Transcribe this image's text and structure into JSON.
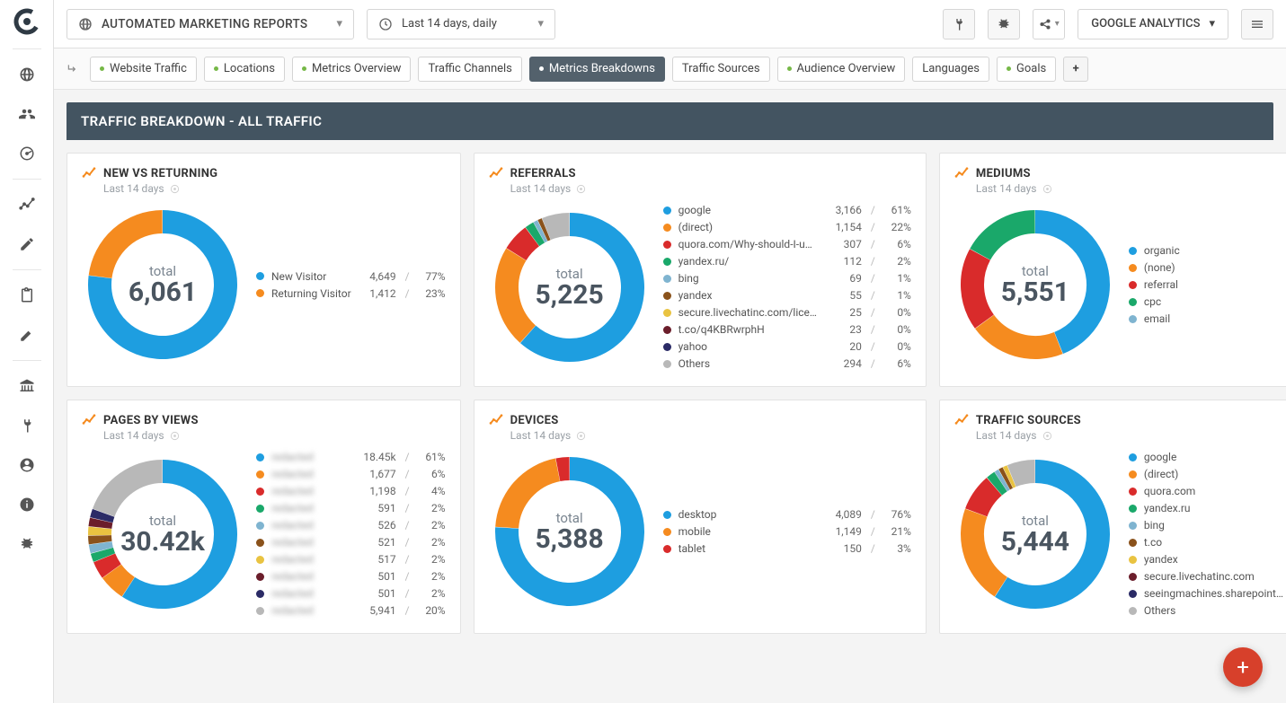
{
  "header": {
    "report_name": "AUTOMATED MARKETING REPORTS",
    "date_range": "Last 14 days, daily",
    "account": "GOOGLE ANALYTICS"
  },
  "tabs": [
    {
      "label": "Website Traffic",
      "dot": true
    },
    {
      "label": "Locations",
      "dot": true
    },
    {
      "label": "Metrics Overview",
      "dot": true
    },
    {
      "label": "Traffic Channels",
      "dot": false
    },
    {
      "label": "Metrics Breakdowns",
      "dot": true,
      "active": true
    },
    {
      "label": "Traffic Sources",
      "dot": false
    },
    {
      "label": "Audience Overview",
      "dot": true
    },
    {
      "label": "Languages",
      "dot": false
    },
    {
      "label": "Goals",
      "dot": true
    }
  ],
  "section_title": "TRAFFIC BREAKDOWN - ALL TRAFFIC",
  "period_label": "Last 14 days",
  "total_label": "total",
  "palette": [
    "#1e9ee0",
    "#f58b1f",
    "#d92b2b",
    "#1aa86a",
    "#7fb4d0",
    "#8a521b",
    "#e9c341",
    "#6b1e2b",
    "#2b2b66",
    "#b8b8b8"
  ],
  "cards": [
    {
      "title": "NEW VS RETURNING",
      "total": "6,061",
      "items": [
        {
          "name": "New Visitor",
          "value": "4,649",
          "pct": "77%"
        },
        {
          "name": "Returning Visitor",
          "value": "1,412",
          "pct": "23%"
        }
      ]
    },
    {
      "title": "REFERRALS",
      "total": "5,225",
      "items": [
        {
          "name": "google",
          "value": "3,166",
          "pct": "61%"
        },
        {
          "name": "(direct)",
          "value": "1,154",
          "pct": "22%"
        },
        {
          "name": "quora.com/Why-should-I-u…",
          "value": "307",
          "pct": "6%"
        },
        {
          "name": "yandex.ru/",
          "value": "112",
          "pct": "2%"
        },
        {
          "name": "bing",
          "value": "69",
          "pct": "1%"
        },
        {
          "name": "yandex",
          "value": "55",
          "pct": "1%"
        },
        {
          "name": "secure.livechatinc.com/lice…",
          "value": "25",
          "pct": "0%"
        },
        {
          "name": "t.co/q4KBRwrphH",
          "value": "23",
          "pct": "0%"
        },
        {
          "name": "yahoo",
          "value": "20",
          "pct": "0%"
        },
        {
          "name": "Others",
          "value": "294",
          "pct": "6%"
        }
      ]
    },
    {
      "title": "MEDIUMS",
      "total": "5,551",
      "items": [
        {
          "name": "organic",
          "value": "2,443",
          "pct": "44%"
        },
        {
          "name": "(none)",
          "value": "1,158",
          "pct": "21%"
        },
        {
          "name": "referral",
          "value": "997",
          "pct": "18%"
        },
        {
          "name": "cpc",
          "value": "939",
          "pct": "17%"
        },
        {
          "name": "email",
          "value": "14",
          "pct": "0%"
        }
      ]
    },
    {
      "title": "PAGES BY VIEWS",
      "total": "30.42k",
      "blur": true,
      "items": [
        {
          "name": "redacted",
          "value": "18.45k",
          "pct": "61%"
        },
        {
          "name": "redacted",
          "value": "1,677",
          "pct": "6%"
        },
        {
          "name": "redacted",
          "value": "1,198",
          "pct": "4%"
        },
        {
          "name": "redacted",
          "value": "591",
          "pct": "2%"
        },
        {
          "name": "redacted",
          "value": "526",
          "pct": "2%"
        },
        {
          "name": "redacted",
          "value": "521",
          "pct": "2%"
        },
        {
          "name": "redacted",
          "value": "517",
          "pct": "2%"
        },
        {
          "name": "redacted",
          "value": "501",
          "pct": "2%"
        },
        {
          "name": "redacted",
          "value": "501",
          "pct": "2%"
        },
        {
          "name": "redacted",
          "value": "5,941",
          "pct": "20%"
        }
      ]
    },
    {
      "title": "DEVICES",
      "total": "5,388",
      "items": [
        {
          "name": "desktop",
          "value": "4,089",
          "pct": "76%"
        },
        {
          "name": "mobile",
          "value": "1,149",
          "pct": "21%"
        },
        {
          "name": "tablet",
          "value": "150",
          "pct": "3%"
        }
      ]
    },
    {
      "title": "TRAFFIC SOURCES",
      "total": "5,444",
      "items": [
        {
          "name": "google",
          "value": "3,176",
          "pct": "58%"
        },
        {
          "name": "(direct)",
          "value": "1,158",
          "pct": "21%"
        },
        {
          "name": "quora.com",
          "value": "460",
          "pct": "8%"
        },
        {
          "name": "yandex.ru",
          "value": "112",
          "pct": "2%"
        },
        {
          "name": "bing",
          "value": "72",
          "pct": "1%"
        },
        {
          "name": "t.co",
          "value": "58",
          "pct": "1%"
        },
        {
          "name": "yandex",
          "value": "55",
          "pct": "1%"
        },
        {
          "name": "secure.livechatinc.com",
          "value": "27",
          "pct": "0%"
        },
        {
          "name": "seeingmachines.sharepoint…",
          "value": "22",
          "pct": "0%"
        },
        {
          "name": "Others",
          "value": "304",
          "pct": "6%"
        }
      ]
    }
  ],
  "chart_data": [
    {
      "type": "pie",
      "title": "NEW VS RETURNING",
      "categories": [
        "New Visitor",
        "Returning Visitor"
      ],
      "values": [
        4649,
        1412
      ],
      "total": 6061
    },
    {
      "type": "pie",
      "title": "REFERRALS",
      "categories": [
        "google",
        "(direct)",
        "quora.com/Why-should-I-u…",
        "yandex.ru/",
        "bing",
        "yandex",
        "secure.livechatinc.com/lice…",
        "t.co/q4KBRwrphH",
        "yahoo",
        "Others"
      ],
      "values": [
        3166,
        1154,
        307,
        112,
        69,
        55,
        25,
        23,
        20,
        294
      ],
      "total": 5225
    },
    {
      "type": "pie",
      "title": "MEDIUMS",
      "categories": [
        "organic",
        "(none)",
        "referral",
        "cpc",
        "email"
      ],
      "values": [
        2443,
        1158,
        997,
        939,
        14
      ],
      "total": 5551
    },
    {
      "type": "pie",
      "title": "PAGES BY VIEWS",
      "categories": [
        "p1",
        "p2",
        "p3",
        "p4",
        "p5",
        "p6",
        "p7",
        "p8",
        "p9",
        "Others"
      ],
      "values": [
        18450,
        1677,
        1198,
        591,
        526,
        521,
        517,
        501,
        501,
        5941
      ],
      "total": 30420
    },
    {
      "type": "pie",
      "title": "DEVICES",
      "categories": [
        "desktop",
        "mobile",
        "tablet"
      ],
      "values": [
        4089,
        1149,
        150
      ],
      "total": 5388
    },
    {
      "type": "pie",
      "title": "TRAFFIC SOURCES",
      "categories": [
        "google",
        "(direct)",
        "quora.com",
        "yandex.ru",
        "bing",
        "t.co",
        "yandex",
        "secure.livechatinc.com",
        "seeingmachines.sharepoint…",
        "Others"
      ],
      "values": [
        3176,
        1158,
        460,
        112,
        72,
        58,
        55,
        27,
        22,
        304
      ],
      "total": 5444
    }
  ]
}
